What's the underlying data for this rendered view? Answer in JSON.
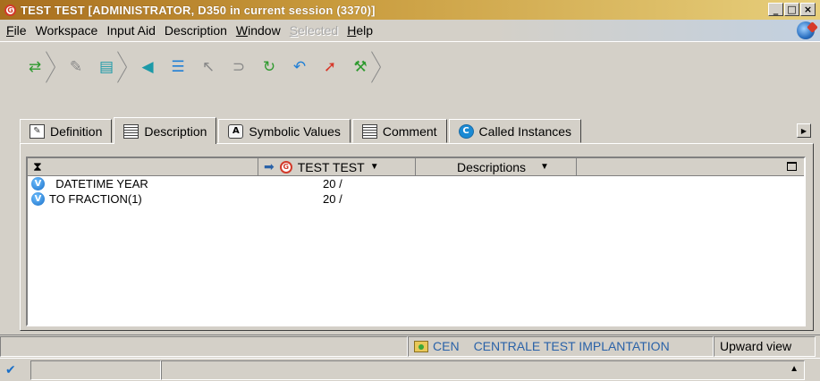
{
  "window": {
    "title": "TEST TEST [ADMINISTRATOR, D350 in current session (3370)]",
    "icon": "G",
    "minimize": "_",
    "maximize": "□",
    "close": "×"
  },
  "menu": {
    "items": [
      {
        "first": "F",
        "rest": "ile",
        "underline_first": true
      },
      {
        "first": "",
        "rest": "Workspace",
        "underline_first": false
      },
      {
        "first": "",
        "rest": "Input Aid",
        "underline_first": false
      },
      {
        "first": "",
        "rest": "Description",
        "underline_first": false
      },
      {
        "first": "W",
        "rest": "indow",
        "underline_first": true
      },
      {
        "first": "S",
        "rest": "elected",
        "underline_first": true,
        "disabled": true
      },
      {
        "first": "H",
        "rest": "elp",
        "underline_first": true
      }
    ]
  },
  "toolbar": {
    "icons": [
      "refresh-tree-icon",
      "edit-icon",
      "document-icon",
      "arrow-left-icon",
      "list-arrow-icon",
      "cursor-icon",
      "connect-icon",
      "sync-icon",
      "undo-icon",
      "pointer-icon",
      "tools-icon"
    ]
  },
  "tabs": [
    {
      "label": "Definition",
      "icon": "definition-icon"
    },
    {
      "label": "Description",
      "icon": "description-icon",
      "active": true
    },
    {
      "label": "Symbolic Values",
      "icon": "symbolic-values-icon"
    },
    {
      "label": "Comment",
      "icon": "comment-icon"
    },
    {
      "label": "Called Instances",
      "icon": "called-instances-icon"
    }
  ],
  "grid": {
    "header": {
      "col1_icon": "⧗",
      "instance": "TEST TEST",
      "instance_icon": "G",
      "descriptions": "Descriptions",
      "dropdown": "▼",
      "arrow": "➡"
    },
    "rows": [
      {
        "badge": "V",
        "name": "  DATETIME YEAR",
        "value": "20 /"
      },
      {
        "badge": "V",
        "name": "TO FRACTION(1)",
        "value": "20 /"
      }
    ]
  },
  "status": {
    "env_code": "CEN",
    "env_name": "CENTRALE TEST IMPLANTATION",
    "view": "Upward view"
  },
  "bottom": {
    "check": "✔",
    "arrow": "▲"
  },
  "colors": {
    "title_start": "#a86e1e",
    "title_end": "#e7cf7c",
    "accent_blue": "#2a62a8"
  }
}
